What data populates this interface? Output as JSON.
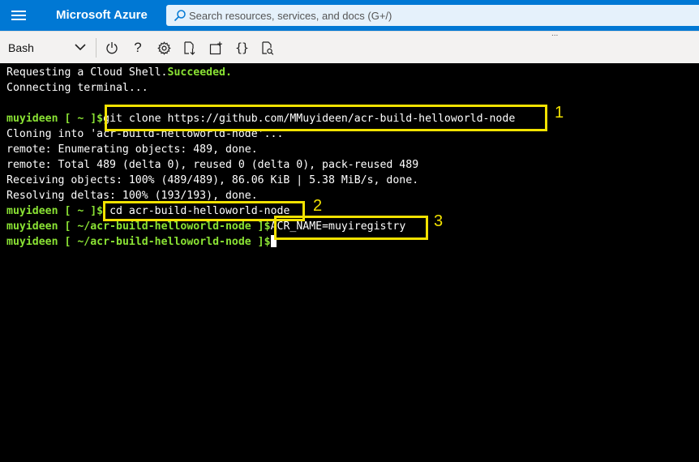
{
  "header": {
    "brand": "Microsoft Azure",
    "search_placeholder": "Search resources, services, and docs (G+/)"
  },
  "toolbar": {
    "shell": "Bash",
    "help_glyph": "?",
    "editor_glyph": "{}",
    "drag_handle": "..."
  },
  "terminal": {
    "line1": {
      "text": "Requesting a Cloud Shell.",
      "status": "Succeeded."
    },
    "line2": "Connecting terminal...",
    "prompt_home": {
      "user": "muyideen",
      "path": "[ ~ ]$"
    },
    "prompt_repo": {
      "user": "muyideen",
      "path": "[ ~/acr-build-helloworld-node ]$"
    },
    "cmd1": "git clone https://github.com/MMuyideen/acr-build-helloworld-node",
    "out1": "Cloning into 'acr-build-helloworld-node'...",
    "out2": "remote: Enumerating objects: 489, done.",
    "out3": "remote: Total 489 (delta 0), reused 0 (delta 0), pack-reused 489",
    "out4": "Receiving objects: 100% (489/489), 86.06 KiB | 5.38 MiB/s, done.",
    "out5": "Resolving deltas: 100% (193/193), done.",
    "cmd2": "cd acr-build-helloworld-node",
    "cmd3": "ACR_NAME=muyiregistry"
  },
  "annotations": {
    "n1": "1",
    "n2": "2",
    "n3": "3"
  },
  "colors": {
    "azure_blue": "#0078d4",
    "prompt_green": "#8ae234",
    "annotation_yellow": "#f2e200"
  }
}
